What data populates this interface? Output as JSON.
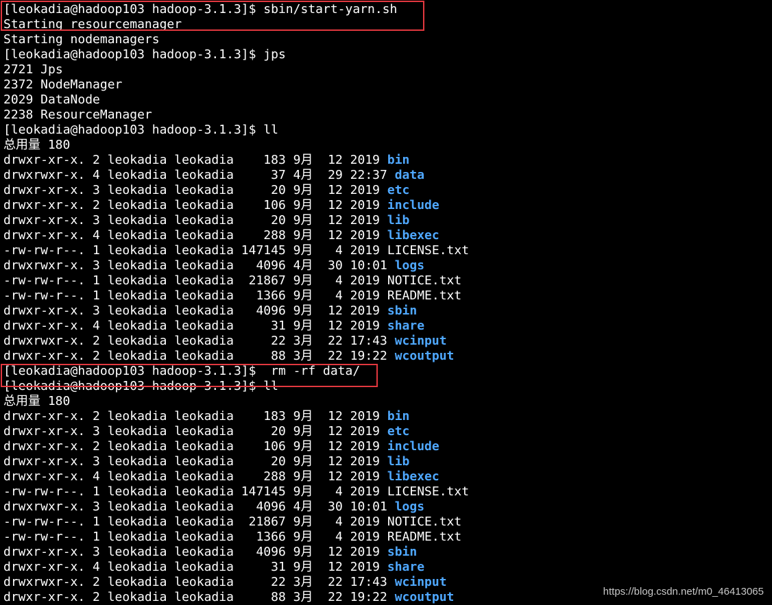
{
  "colors": {
    "background": "#000000",
    "text": "#ffffff",
    "directory": "#4fa8ff",
    "highlight_box": "#e2383f",
    "watermark": "#c8c8c8"
  },
  "terminal": {
    "lines": [
      {
        "type": "prompt",
        "text": "[leokadia@hadoop103 hadoop-3.1.3]$ sbin/start-yarn.sh"
      },
      {
        "type": "output",
        "text": "Starting resourcemanager"
      },
      {
        "type": "output",
        "text": "Starting nodemanagers"
      },
      {
        "type": "prompt",
        "text": "[leokadia@hadoop103 hadoop-3.1.3]$ jps"
      },
      {
        "type": "output",
        "text": "2721 Jps"
      },
      {
        "type": "output",
        "text": "2372 NodeManager"
      },
      {
        "type": "output",
        "text": "2029 DataNode"
      },
      {
        "type": "output",
        "text": "2238 ResourceManager"
      },
      {
        "type": "prompt",
        "text": "[leokadia@hadoop103 hadoop-3.1.3]$ ll"
      },
      {
        "type": "output",
        "text": "总用量 180"
      },
      {
        "type": "entry",
        "prefix": "drwxr-xr-x. 2 leokadia leokadia    183 9月  12 2019 ",
        "name": "bin",
        "dir": true
      },
      {
        "type": "entry",
        "prefix": "drwxrwxr-x. 4 leokadia leokadia     37 4月  29 22:37 ",
        "name": "data",
        "dir": true
      },
      {
        "type": "entry",
        "prefix": "drwxr-xr-x. 3 leokadia leokadia     20 9月  12 2019 ",
        "name": "etc",
        "dir": true
      },
      {
        "type": "entry",
        "prefix": "drwxr-xr-x. 2 leokadia leokadia    106 9月  12 2019 ",
        "name": "include",
        "dir": true
      },
      {
        "type": "entry",
        "prefix": "drwxr-xr-x. 3 leokadia leokadia     20 9月  12 2019 ",
        "name": "lib",
        "dir": true
      },
      {
        "type": "entry",
        "prefix": "drwxr-xr-x. 4 leokadia leokadia    288 9月  12 2019 ",
        "name": "libexec",
        "dir": true
      },
      {
        "type": "entry",
        "prefix": "-rw-rw-r--. 1 leokadia leokadia 147145 9月   4 2019 ",
        "name": "LICENSE.txt",
        "dir": false
      },
      {
        "type": "entry",
        "prefix": "drwxrwxr-x. 3 leokadia leokadia   4096 4月  30 10:01 ",
        "name": "logs",
        "dir": true
      },
      {
        "type": "entry",
        "prefix": "-rw-rw-r--. 1 leokadia leokadia  21867 9月   4 2019 ",
        "name": "NOTICE.txt",
        "dir": false
      },
      {
        "type": "entry",
        "prefix": "-rw-rw-r--. 1 leokadia leokadia   1366 9月   4 2019 ",
        "name": "README.txt",
        "dir": false
      },
      {
        "type": "entry",
        "prefix": "drwxr-xr-x. 3 leokadia leokadia   4096 9月  12 2019 ",
        "name": "sbin",
        "dir": true
      },
      {
        "type": "entry",
        "prefix": "drwxr-xr-x. 4 leokadia leokadia     31 9月  12 2019 ",
        "name": "share",
        "dir": true
      },
      {
        "type": "entry",
        "prefix": "drwxrwxr-x. 2 leokadia leokadia     22 3月  22 17:43 ",
        "name": "wcinput",
        "dir": true
      },
      {
        "type": "entry",
        "prefix": "drwxr-xr-x. 2 leokadia leokadia     88 3月  22 19:22 ",
        "name": "wcoutput",
        "dir": true
      },
      {
        "type": "prompt",
        "text": "[leokadia@hadoop103 hadoop-3.1.3]$  rm -rf data/"
      },
      {
        "type": "prompt",
        "text": "[leokadia@hadoop103 hadoop-3.1.3]$ ll"
      },
      {
        "type": "output",
        "text": "总用量 180"
      },
      {
        "type": "entry",
        "prefix": "drwxr-xr-x. 2 leokadia leokadia    183 9月  12 2019 ",
        "name": "bin",
        "dir": true
      },
      {
        "type": "entry",
        "prefix": "drwxr-xr-x. 3 leokadia leokadia     20 9月  12 2019 ",
        "name": "etc",
        "dir": true
      },
      {
        "type": "entry",
        "prefix": "drwxr-xr-x. 2 leokadia leokadia    106 9月  12 2019 ",
        "name": "include",
        "dir": true
      },
      {
        "type": "entry",
        "prefix": "drwxr-xr-x. 3 leokadia leokadia     20 9月  12 2019 ",
        "name": "lib",
        "dir": true
      },
      {
        "type": "entry",
        "prefix": "drwxr-xr-x. 4 leokadia leokadia    288 9月  12 2019 ",
        "name": "libexec",
        "dir": true
      },
      {
        "type": "entry",
        "prefix": "-rw-rw-r--. 1 leokadia leokadia 147145 9月   4 2019 ",
        "name": "LICENSE.txt",
        "dir": false
      },
      {
        "type": "entry",
        "prefix": "drwxrwxr-x. 3 leokadia leokadia   4096 4月  30 10:01 ",
        "name": "logs",
        "dir": true
      },
      {
        "type": "entry",
        "prefix": "-rw-rw-r--. 1 leokadia leokadia  21867 9月   4 2019 ",
        "name": "NOTICE.txt",
        "dir": false
      },
      {
        "type": "entry",
        "prefix": "-rw-rw-r--. 1 leokadia leokadia   1366 9月   4 2019 ",
        "name": "README.txt",
        "dir": false
      },
      {
        "type": "entry",
        "prefix": "drwxr-xr-x. 3 leokadia leokadia   4096 9月  12 2019 ",
        "name": "sbin",
        "dir": true
      },
      {
        "type": "entry",
        "prefix": "drwxr-xr-x. 4 leokadia leokadia     31 9月  12 2019 ",
        "name": "share",
        "dir": true
      },
      {
        "type": "entry",
        "prefix": "drwxrwxr-x. 2 leokadia leokadia     22 3月  22 17:43 ",
        "name": "wcinput",
        "dir": true
      },
      {
        "type": "entry",
        "prefix": "drwxr-xr-x. 2 leokadia leokadia     88 3月  22 19:22 ",
        "name": "wcoutput",
        "dir": true
      }
    ]
  },
  "watermark": {
    "text": "https://blog.csdn.net/m0_46413065"
  }
}
